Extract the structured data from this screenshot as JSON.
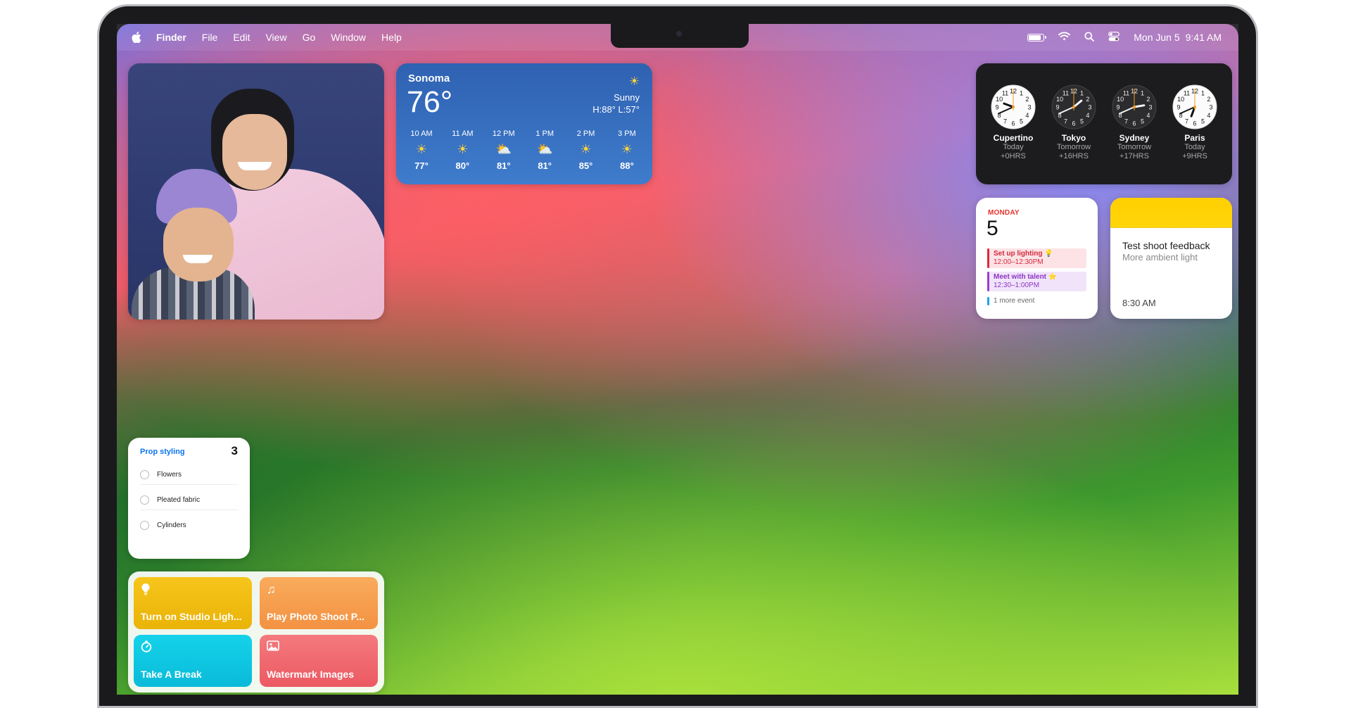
{
  "menubar": {
    "app": "Finder",
    "menus": [
      "File",
      "Edit",
      "View",
      "Go",
      "Window",
      "Help"
    ],
    "date": "Mon Jun 5",
    "time": "9:41 AM",
    "icons": [
      "apple-icon",
      "battery-icon",
      "wifi-icon",
      "search-icon",
      "control-center-icon"
    ]
  },
  "weather": {
    "city": "Sonoma",
    "temp": "76°",
    "condition": "Sunny",
    "hilo": "H:88° L:57°",
    "hours": [
      {
        "time": "10 AM",
        "icon": "sun-icon",
        "temp": "77°"
      },
      {
        "time": "11 AM",
        "icon": "sun-icon",
        "temp": "80°"
      },
      {
        "time": "12 PM",
        "icon": "partly-cloudy-icon",
        "temp": "81°"
      },
      {
        "time": "1 PM",
        "icon": "partly-cloudy-icon",
        "temp": "81°"
      },
      {
        "time": "2 PM",
        "icon": "sun-icon",
        "temp": "85°"
      },
      {
        "time": "3 PM",
        "icon": "sun-icon",
        "temp": "88°"
      }
    ]
  },
  "clocks": [
    {
      "city": "Cupertino",
      "day": "Today",
      "offset": "+0HRS"
    },
    {
      "city": "Tokyo",
      "day": "Tomorrow",
      "offset": "+16HRS"
    },
    {
      "city": "Sydney",
      "day": "Tomorrow",
      "offset": "+17HRS"
    },
    {
      "city": "Paris",
      "day": "Today",
      "offset": "+9HRS"
    }
  ],
  "calendar": {
    "weekday": "MONDAY",
    "day": "5",
    "events": [
      {
        "title": "Set up lighting 💡",
        "time": "12:00–12:30PM"
      },
      {
        "title": "Meet with talent ⭐",
        "time": "12:30–1:00PM"
      }
    ],
    "more": "1 more event"
  },
  "notes": {
    "title": "Test shoot feedback",
    "preview": "More ambient light",
    "time": "8:30 AM"
  },
  "reminders": {
    "list": "Prop styling",
    "count": "3",
    "items": [
      "Flowers",
      "Pleated fabric",
      "Cylinders"
    ]
  },
  "shortcuts": [
    {
      "label": "Turn on Studio Ligh...",
      "icon": "lightbulb-icon"
    },
    {
      "label": "Play Photo Shoot P...",
      "icon": "music-note-icon"
    },
    {
      "label": "Take A Break",
      "icon": "timer-icon"
    },
    {
      "label": "Watermark Images",
      "icon": "photo-icon"
    }
  ]
}
